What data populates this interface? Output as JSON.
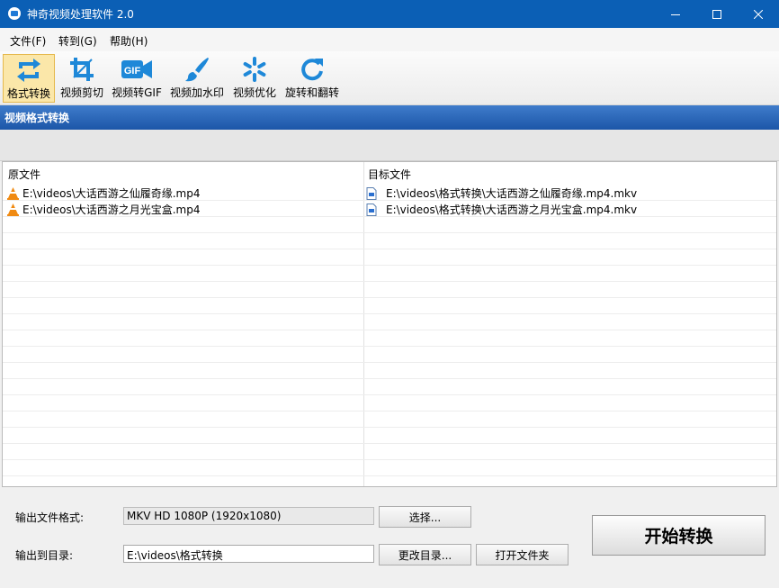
{
  "window": {
    "title": "神奇视频处理软件 2.0"
  },
  "menu": [
    {
      "label": "文件(F)"
    },
    {
      "label": "转到(G)"
    },
    {
      "label": "帮助(H)"
    }
  ],
  "toolbar": {
    "items": [
      {
        "label": "格式转换",
        "icon": "convert-icon",
        "selected": true
      },
      {
        "label": "视频剪切",
        "icon": "crop-icon"
      },
      {
        "label": "视频转GIF",
        "icon": "gif-icon"
      },
      {
        "label": "视频加水印",
        "icon": "brush-icon"
      },
      {
        "label": "视频优化",
        "icon": "optimize-icon"
      },
      {
        "label": "旋转和翻转",
        "icon": "rotate-icon"
      }
    ]
  },
  "panel": {
    "title": "视频格式转换"
  },
  "table": {
    "columns": [
      "原文件",
      "目标文件"
    ],
    "rows": [
      {
        "source": "E:\\videos\\大话西游之仙履奇缘.mp4",
        "target": "E:\\videos\\格式转换\\大话西游之仙履奇缘.mp4.mkv"
      },
      {
        "source": "E:\\videos\\大话西游之月光宝盒.mp4",
        "target": "E:\\videos\\格式转换\\大话西游之月光宝盒.mp4.mkv"
      }
    ]
  },
  "output": {
    "format_label": "输出文件格式:",
    "format_value": "MKV HD 1080P (1920x1080)",
    "choose_button": "选择...",
    "dir_label": "输出到目录:",
    "dir_value": "E:\\videos\\格式转换",
    "change_dir_button": "更改目录...",
    "open_folder_button": "打开文件夹",
    "start_button": "开始转换"
  },
  "colors": {
    "titlebar": "#0b5fb5",
    "panel_header": "#1c56a8",
    "icon_blue": "#1e88d8",
    "selected_tool": "#fbe7a9"
  }
}
